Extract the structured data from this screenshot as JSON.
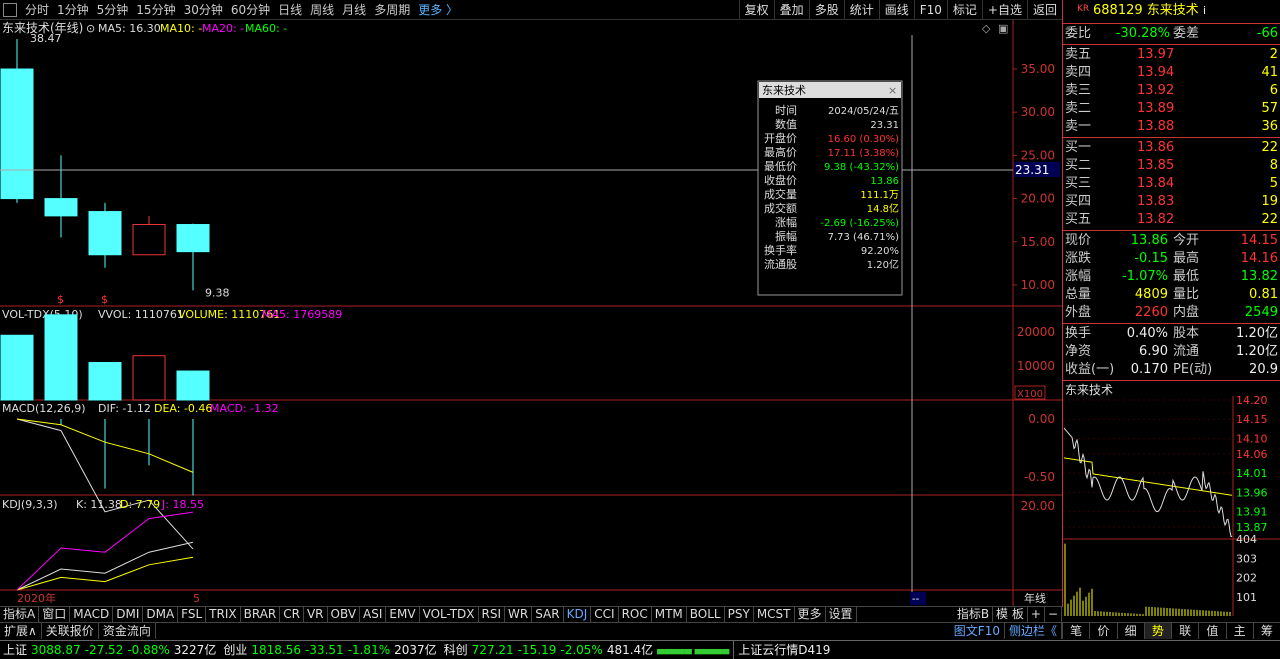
{
  "toolbar": {
    "tabs": [
      "分时",
      "1分钟",
      "5分钟",
      "15分钟",
      "30分钟",
      "60分钟",
      "日线",
      "周线",
      "月线",
      "多周期"
    ],
    "more": "更多 〉",
    "buttons": [
      "复权",
      "叠加",
      "多股",
      "统计",
      "画线",
      "F10",
      "标记",
      "+自选",
      "返回"
    ]
  },
  "chart": {
    "title": "东来技术(年线)",
    "ma_labels": [
      "MA5: 16.30",
      "MA10: -",
      "MA20: -",
      "MA60: -"
    ],
    "high_label": "38.47",
    "low_label": "9.38",
    "cursor_price": "23.31",
    "price_ticks": [
      "35.00",
      "30.00",
      "25.00",
      "20.00",
      "15.00",
      "10.00"
    ],
    "vol_title": "VOL-TDX(5,10)",
    "vol_labels": [
      "VVOL: 1110761",
      "VOLUME: 1110761",
      "MA5: 1769589"
    ],
    "vol_ticks": [
      "20000",
      "10000"
    ],
    "vol_unit": "X100",
    "macd_title": "MACD(12,26,9)",
    "macd_labels": [
      "DIF: -1.12",
      "DEA: -0.46",
      "MACD: -1.32"
    ],
    "macd_ticks": [
      "0.00",
      "-0.50"
    ],
    "kdj_title": "KDJ(9,3,3)",
    "kdj_labels": [
      "K: 11.38",
      "D: 7.79",
      "J: 18.55"
    ],
    "kdj_ticks": [
      "20.00"
    ],
    "x_labels": [
      "2020年",
      "5"
    ],
    "period_label": "年线",
    "marker": "--"
  },
  "chart_data": {
    "type": "candlestick",
    "candles": [
      {
        "open": 20,
        "high": 38.47,
        "low": 19.5,
        "close": 35
      },
      {
        "open": 18,
        "high": 25,
        "low": 15.5,
        "close": 20
      },
      {
        "open": 18.5,
        "high": 19.5,
        "low": 12,
        "close": 13.5
      },
      {
        "open": 13.5,
        "high": 18,
        "low": 13.5,
        "close": 17
      },
      {
        "open": 17,
        "high": 17.11,
        "low": 9.38,
        "close": 13.86
      }
    ],
    "volumes": [
      19000,
      25000,
      11000,
      13000,
      8500
    ],
    "dif": [
      0,
      -0.1,
      -0.8,
      -0.7,
      -1.12
    ],
    "dea": [
      0,
      -0.05,
      -0.2,
      -0.3,
      -0.46
    ],
    "k": [
      0,
      5,
      4,
      9,
      11.38
    ],
    "d": [
      0,
      3,
      2,
      6,
      7.79
    ],
    "j": [
      0,
      10,
      9,
      17,
      18.55
    ]
  },
  "tooltip": {
    "title": "东来技术",
    "rows": [
      {
        "label": "时间",
        "value": "2024/05/24/五",
        "color": "#ddd"
      },
      {
        "label": "数值",
        "value": "23.31",
        "color": "#ddd"
      },
      {
        "label": "开盘价",
        "value": "16.60 (0.30%)",
        "color": "#f33"
      },
      {
        "label": "最高价",
        "value": "17.11 (3.38%)",
        "color": "#f33"
      },
      {
        "label": "最低价",
        "value": "9.38 (-43.32%)",
        "color": "#0f0"
      },
      {
        "label": "收盘价",
        "value": "13.86",
        "color": "#0f0"
      },
      {
        "label": "成交量",
        "value": "111.1万",
        "color": "#ff0"
      },
      {
        "label": "成交额",
        "value": "14.8亿",
        "color": "#ff0"
      },
      {
        "label": "涨幅",
        "value": "-2.69 (-16.25%)",
        "color": "#0f0"
      },
      {
        "label": "振幅",
        "value": "7.73 (46.71%)",
        "color": "#ddd"
      },
      {
        "label": "换手率",
        "value": "92.20%",
        "color": "#ddd"
      },
      {
        "label": "流通股",
        "value": "1.20亿",
        "color": "#ddd"
      }
    ]
  },
  "quote": {
    "kr": "KR",
    "code": "688129",
    "name": "东来技术",
    "weibi_label": "委比",
    "weibi": "-30.28%",
    "weicha_label": "委差",
    "weicha": "-66",
    "asks": [
      {
        "label": "卖五",
        "price": "13.97",
        "vol": "2"
      },
      {
        "label": "卖四",
        "price": "13.94",
        "vol": "41"
      },
      {
        "label": "卖三",
        "price": "13.92",
        "vol": "6"
      },
      {
        "label": "卖二",
        "price": "13.89",
        "vol": "57"
      },
      {
        "label": "卖一",
        "price": "13.88",
        "vol": "36"
      }
    ],
    "bids": [
      {
        "label": "买一",
        "price": "13.86",
        "vol": "22"
      },
      {
        "label": "买二",
        "price": "13.85",
        "vol": "8"
      },
      {
        "label": "买三",
        "price": "13.84",
        "vol": "5"
      },
      {
        "label": "买四",
        "price": "13.83",
        "vol": "19"
      },
      {
        "label": "买五",
        "price": "13.82",
        "vol": "22"
      }
    ],
    "stats": [
      {
        "l1": "现价",
        "v1": "13.86",
        "c1": "#0f0",
        "l2": "今开",
        "v2": "14.15",
        "c2": "#f33"
      },
      {
        "l1": "涨跌",
        "v1": "-0.15",
        "c1": "#0f0",
        "l2": "最高",
        "v2": "14.16",
        "c2": "#f33"
      },
      {
        "l1": "涨幅",
        "v1": "-1.07%",
        "c1": "#0f0",
        "l2": "最低",
        "v2": "13.82",
        "c2": "#0f0"
      },
      {
        "l1": "总量",
        "v1": "4809",
        "c1": "#ff0",
        "l2": "量比",
        "v2": "0.81",
        "c2": "#ff0"
      },
      {
        "l1": "外盘",
        "v1": "2260",
        "c1": "#f33",
        "l2": "内盘",
        "v2": "2549",
        "c2": "#0f0"
      }
    ],
    "stats2": [
      {
        "l1": "换手",
        "v1": "0.40%",
        "l2": "股本",
        "v2": "1.20亿"
      },
      {
        "l1": "净资",
        "v1": "6.90",
        "l2": "流通",
        "v2": "1.20亿"
      },
      {
        "l1": "收益(一)",
        "v1": "0.170",
        "l2": "PE(动)",
        "v2": "20.9"
      }
    ],
    "mini_title": "东来技术",
    "mini_ticks": [
      "14.20",
      "14.15",
      "14.10",
      "14.06",
      "14.01",
      "13.96",
      "13.91",
      "13.87"
    ],
    "mini_vol_ticks": [
      "404",
      "303",
      "202",
      "101"
    ]
  },
  "bottom": {
    "indicators": [
      "指标A",
      "窗口",
      "MACD",
      "DMI",
      "DMA",
      "FSL",
      "TRIX",
      "BRAR",
      "CR",
      "VR",
      "OBV",
      "ASI",
      "EMV",
      "VOL-TDX",
      "RSI",
      "WR",
      "SAR",
      "KDJ",
      "CCI",
      "ROC",
      "MTM",
      "BOLL",
      "PSY",
      "MCST",
      "更多",
      "设置"
    ],
    "active": "KDJ",
    "right_tabs": [
      "指标B",
      "模 板",
      "+",
      "−"
    ],
    "row2": [
      "扩展∧",
      "关联报价",
      "资金流向"
    ],
    "row2_right": [
      "图文F10",
      "侧边栏《"
    ],
    "quote_tabs": [
      "笔",
      "价",
      "细",
      "势",
      "联",
      "值",
      "主",
      "筹"
    ],
    "quote_active": "势"
  },
  "status": {
    "indices": [
      {
        "name": "上证",
        "val": "3088.87",
        "chg": "-27.52",
        "pct": "-0.88%",
        "amt": "3227亿"
      },
      {
        "name": "创业",
        "val": "1818.56",
        "chg": "-33.51",
        "pct": "-1.81%",
        "amt": "2037亿"
      },
      {
        "name": "科创",
        "val": "727.21",
        "chg": "-15.19",
        "pct": "-2.05%",
        "amt": "481.4亿"
      }
    ],
    "cloud": "上证云行情D419"
  }
}
